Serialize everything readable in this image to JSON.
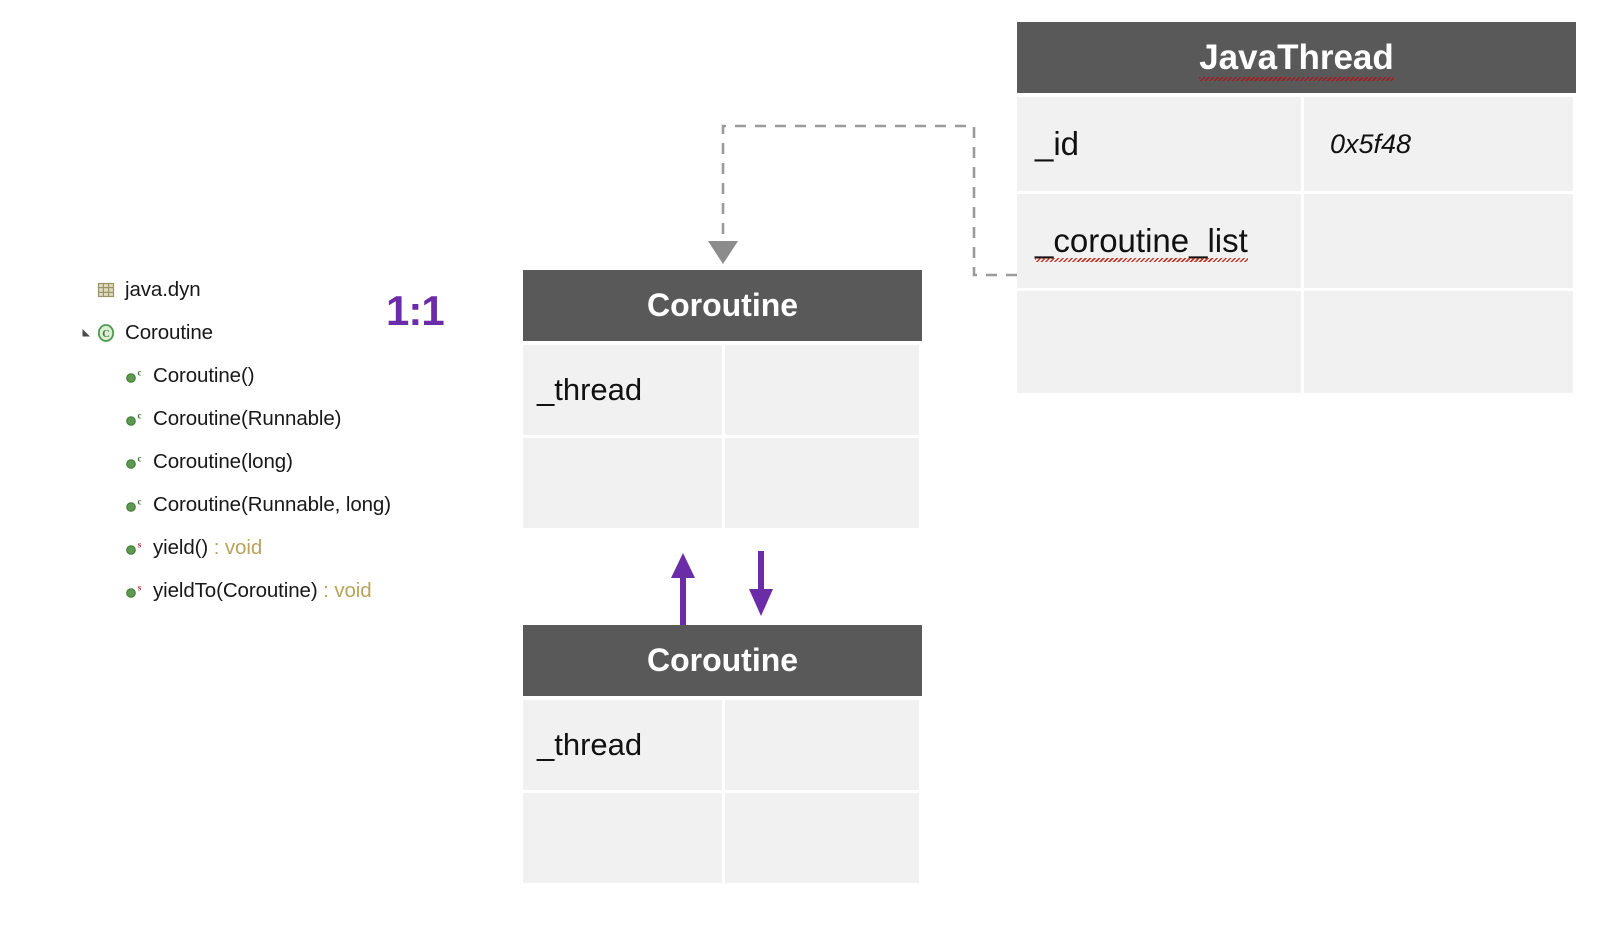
{
  "outline": {
    "items": [
      {
        "label": "java.dyn",
        "icon": "package-icon",
        "indent": 1,
        "twisty": false,
        "kind": "package"
      },
      {
        "label": "Coroutine",
        "icon": "class-icon",
        "indent": 1,
        "twisty": true,
        "kind": "class"
      },
      {
        "label": "Coroutine()",
        "icon": "constructor-icon",
        "indent": 2,
        "twisty": false,
        "kind": "constructor",
        "modifier": "c"
      },
      {
        "label": "Coroutine(Runnable)",
        "icon": "constructor-icon",
        "indent": 2,
        "twisty": false,
        "kind": "constructor",
        "modifier": "c"
      },
      {
        "label": "Coroutine(long)",
        "icon": "constructor-icon",
        "indent": 2,
        "twisty": false,
        "kind": "constructor",
        "modifier": "c"
      },
      {
        "label": "Coroutine(Runnable, long)",
        "icon": "constructor-icon",
        "indent": 2,
        "twisty": false,
        "kind": "constructor",
        "modifier": "c"
      },
      {
        "label": "yield()",
        "return_type": " : void",
        "icon": "static-method-icon",
        "indent": 2,
        "twisty": false,
        "kind": "method",
        "modifier": "s"
      },
      {
        "label": "yieldTo(Coroutine)",
        "return_type": " : void",
        "icon": "static-method-icon",
        "indent": 2,
        "twisty": false,
        "kind": "method",
        "modifier": "s"
      }
    ]
  },
  "cardinality": {
    "label": "1:1"
  },
  "javathread": {
    "title": "JavaThread",
    "rows": [
      {
        "name": "_id",
        "value": "0x5f48",
        "spellcheck": false
      },
      {
        "name": "_coroutine_list",
        "value": "",
        "spellcheck": true
      },
      {
        "name": "",
        "value": "",
        "spellcheck": false
      }
    ]
  },
  "coroutine_top": {
    "title": "Coroutine",
    "rows": [
      {
        "name": "_thread",
        "value": ""
      },
      {
        "name": "",
        "value": ""
      }
    ]
  },
  "coroutine_bottom": {
    "title": "Coroutine",
    "rows": [
      {
        "name": "_thread",
        "value": ""
      },
      {
        "name": "",
        "value": ""
      }
    ]
  },
  "colors": {
    "header_bg": "#595959",
    "cell_bg": "#f1f1f1",
    "accent_purple": "#6b2ca8",
    "connector_gray": "#9a9a9a",
    "spellcheck_red": "#c0392b",
    "class_icon_green": "#4f9a4f",
    "package_icon_khaki": "#b3ad7a",
    "return_type_khaki": "#b8a45c",
    "static_modifier_red": "#b03a3a"
  }
}
